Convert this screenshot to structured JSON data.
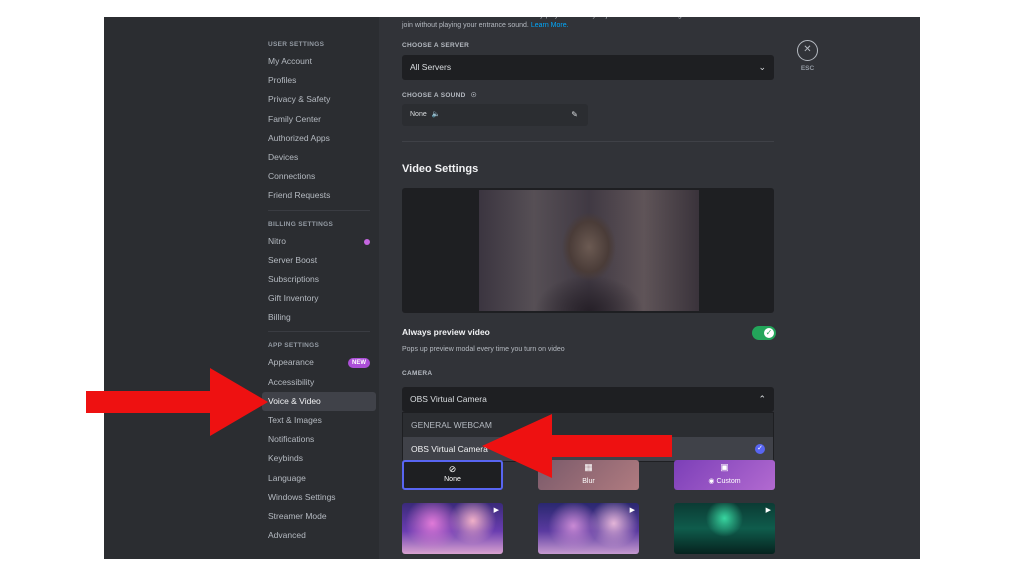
{
  "sidebar": {
    "sections": [
      {
        "heading": "USER SETTINGS",
        "items": [
          "My Account",
          "Profiles",
          "Privacy & Safety",
          "Family Center",
          "Authorized Apps",
          "Devices",
          "Connections",
          "Friend Requests"
        ]
      },
      {
        "heading": "BILLING SETTINGS",
        "items": [
          "Nitro",
          "Server Boost",
          "Subscriptions",
          "Gift Inventory",
          "Billing"
        ]
      },
      {
        "heading": "APP SETTINGS",
        "items": [
          "Appearance",
          "Accessibility",
          "Voice & Video",
          "Text & Images",
          "Notifications",
          "Keybinds",
          "Language",
          "Windows Settings",
          "Streamer Mode",
          "Advanced"
        ]
      }
    ],
    "active_item": "Voice & Video",
    "appearance_badge": "NEW"
  },
  "soundboard": {
    "description": "Choose a Soundboard sound to automatically play whenever you join a voice channel. Right-click on a voice channel to join without playing your entrance sound.",
    "learn_more": "Learn More.",
    "server_label": "CHOOSE A SERVER",
    "server_value": "All Servers",
    "sound_label": "CHOOSE A SOUND",
    "sound_value": "None"
  },
  "video": {
    "heading": "Video Settings",
    "always_preview_title": "Always preview video",
    "always_preview_desc": "Pops up preview modal every time you turn on video",
    "always_preview_enabled": true,
    "camera_label": "CAMERA",
    "camera_value": "OBS Virtual Camera",
    "camera_options": [
      "GENERAL WEBCAM",
      "OBS Virtual Camera"
    ],
    "camera_selected_index": 1,
    "backgrounds": {
      "none": "None",
      "blur": "Blur",
      "custom": "Custom"
    }
  },
  "close": {
    "label": "ESC"
  },
  "colors": {
    "accent": "#5865f2",
    "toggle_on": "#23a55a",
    "arrow": "#ee1111",
    "link": "#00a8fc"
  },
  "icons": [
    "chevron-down-icon",
    "chevron-up-icon",
    "pencil-icon",
    "speaker-icon",
    "check-icon",
    "close-icon",
    "no-background-icon",
    "blur-icon",
    "upload-image-icon",
    "play-icon"
  ]
}
